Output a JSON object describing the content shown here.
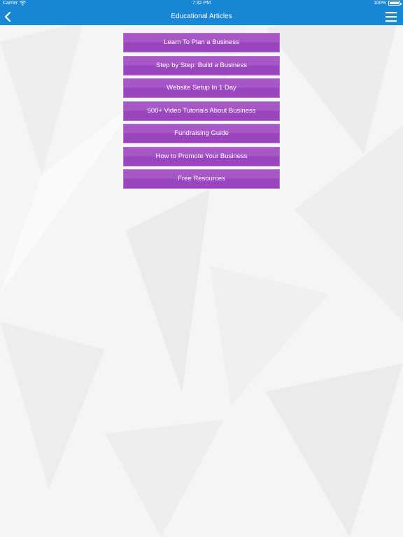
{
  "status_bar": {
    "carrier": "Carrier",
    "time": "7:32 PM",
    "battery": "100%",
    "icons": [
      "wifi-icon",
      "battery-icon"
    ]
  },
  "nav_bar": {
    "title": "Educational Articles",
    "back_icon": "chevron-left-icon",
    "menu_icon": "hamburger-menu-icon"
  },
  "menu": {
    "items": [
      {
        "label": "Learn To Plan a Business"
      },
      {
        "label": "Step by Step: Build a Business"
      },
      {
        "label": "Website Setup In 1 Day"
      },
      {
        "label": "500+ Video Tutorials About Business"
      },
      {
        "label": "Fundraising Guide"
      },
      {
        "label": "How to Promote Your Business"
      },
      {
        "label": "Free Resources"
      }
    ]
  },
  "colors": {
    "accent": "#1a87d6",
    "button": "#a857c6",
    "button_dark": "#9a45bd",
    "background": "#f4f5f6"
  }
}
